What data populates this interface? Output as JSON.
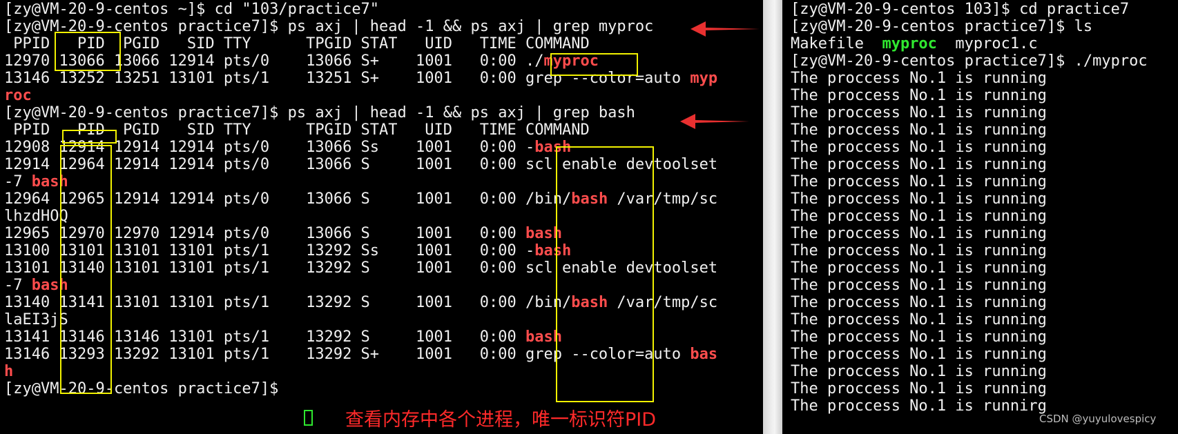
{
  "left_terminal": {
    "lines": [
      "[zy@VM-20-9-centos ~]$ cd \"103/practice7\"",
      "[zy@VM-20-9-centos practice7]$ ps axj | head -1 && ps axj | grep myproc",
      " PPID   PID  PGID   SID TTY      TPGID STAT   UID   TIME COMMAND",
      "12970 13066 13066 12914 pts/0    13066 S+    1001   0:00 ./",
      "13146 13252 13251 13101 pts/1    13251 S+    1001   0:00 grep --color=auto ",
      "",
      "[zy@VM-20-9-centos practice7]$ ps axj | head -1 && ps axj | grep bash",
      " PPID   PID  PGID   SID TTY      TPGID STAT   UID   TIME COMMAND",
      "12908 12914 12914 12914 pts/0    13066 Ss    1001   0:00 -",
      "12914 12964 12914 12914 pts/0    13066 S     1001   0:00 scl enable devtoolset",
      "-7 ",
      "12964 12965 12914 12914 pts/0    13066 S     1001   0:00 /bin/",
      "lhzdHOQ",
      "12965 12970 12970 12914 pts/0    13066 S     1001   0:00 ",
      "13100 13101 13101 13101 pts/1    13292 Ss    1001   0:00 -",
      "13101 13140 13101 13101 pts/1    13292 S     1001   0:00 scl enable devtoolset",
      "-7 ",
      "13140 13141 13101 13101 pts/1    13292 S     1001   0:00 /bin/",
      "laEI3jS",
      "13141 13146 13146 13101 pts/1    13292 S     1001   0:00 ",
      "13146 13293 13292 13101 pts/1    13292 S+    1001   0:00 grep --color=auto ",
      "",
      "[zy@VM-20-9-centos practice7]$ "
    ],
    "highlights": {
      "l3": "myproc",
      "l4": "myp",
      "l5": "roc",
      "l8": "bash",
      "l10": "bash",
      "l11": "bash",
      "l11_after": " /var/tmp/sc",
      "l13": "bash",
      "l14": "bash",
      "l16": "bash",
      "l17": "bash",
      "l17_after": " /var/tmp/sc",
      "l19": "bash",
      "l20": "bas",
      "l21": "h"
    }
  },
  "right_terminal": {
    "line0": "[zy@VM-20-9-centos 103]$ cd practice7",
    "line1": "[zy@VM-20-9-centos practice7]$ ls",
    "ls_makefile": "Makefile  ",
    "ls_myproc": "myproc",
    "ls_source": "  myproc1.c",
    "line3": "[zy@VM-20-9-centos practice7]$ ./myproc",
    "running_text": "The proccess No.1 is running",
    "running_last": "The proccess No.1 is runnirg"
  },
  "annotation": {
    "caption": "查看内存中各个进程，唯一标识符PID",
    "watermark": "CSDN @yuyulovespicy"
  },
  "colors": {
    "highlight_red": "#ff4d4d",
    "exec_green": "#30e830",
    "box_yellow": "#f2f200",
    "arrow_red": "#e83030"
  }
}
